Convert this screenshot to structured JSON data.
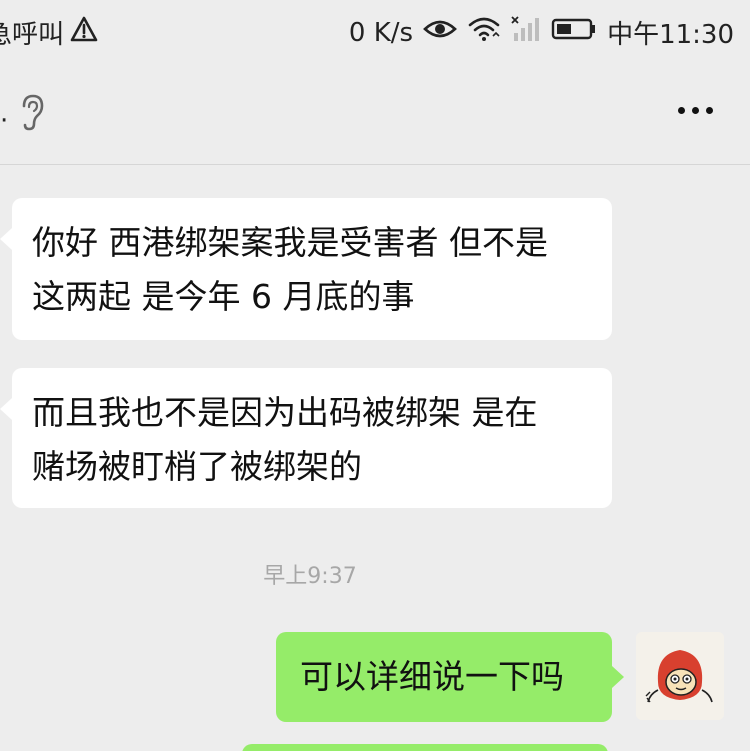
{
  "status_bar": {
    "left_text": "急呼叫",
    "network_speed": "0 K/s",
    "time": "中午11:30",
    "icons": [
      "alert-triangle-icon",
      "eye-icon",
      "wifi-icon",
      "signal-icon",
      "battery-icon"
    ]
  },
  "title_bar": {
    "back_fragment": "·",
    "icons": [
      "ear-icon",
      "more-icon"
    ]
  },
  "messages": [
    {
      "direction": "incoming",
      "lines": [
        "你好 西港绑架案我是受害者 但不是",
        "这两起 是今年 6 月底的事"
      ]
    },
    {
      "direction": "incoming",
      "lines": [
        "而且我也不是因为出码被绑架 是在",
        "赌场被盯梢了被绑架的"
      ]
    },
    {
      "type": "timestamp",
      "text": "早上9:37"
    },
    {
      "direction": "outgoing",
      "lines": [
        "可以详细说一下吗"
      ]
    }
  ],
  "colors": {
    "background": "#ededed",
    "incoming_bubble": "#ffffff",
    "outgoing_bubble": "#95ec69",
    "timestamp": "#a7a7a7"
  }
}
